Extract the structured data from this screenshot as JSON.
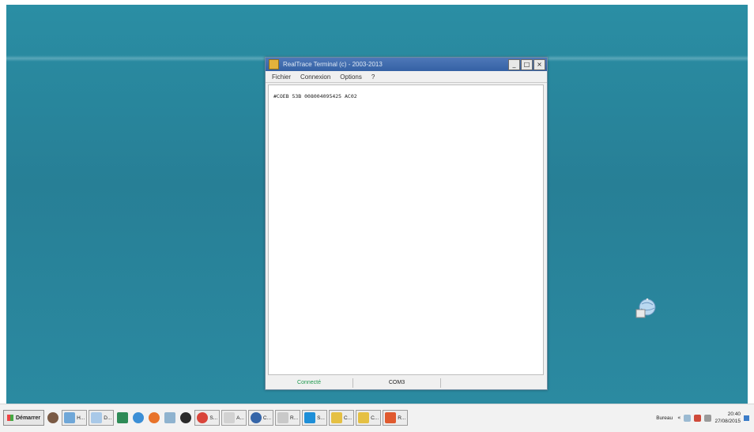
{
  "window": {
    "title": "RealTrace Terminal (c) - 2003-2013",
    "caption": {
      "minimize": "_",
      "maximize": "□",
      "close": "×"
    }
  },
  "menu": [
    "Fichier",
    "Connexion",
    "Options",
    "?"
  ],
  "terminal": {
    "line": "#COEB 53B 008004095425 AC02"
  },
  "statusbar": {
    "connection": "Connecté",
    "port": "COM3"
  },
  "taskbar": {
    "start_label": "Démarrer",
    "items": [
      {
        "label": "",
        "icon": "user-icon",
        "color": "#7a5a45",
        "round": true,
        "button": false
      },
      {
        "label": "H...",
        "icon": "app-icon",
        "color": "#6fa7d8",
        "round": false,
        "button": true
      },
      {
        "label": "D...",
        "icon": "paint-icon",
        "color": "#a9c9e8",
        "round": false,
        "button": true
      },
      {
        "label": "",
        "icon": "excel-icon",
        "color": "#2e8b57",
        "round": false,
        "button": false
      },
      {
        "label": "",
        "icon": "ie-icon",
        "color": "#3c8fd6",
        "round": true,
        "button": false
      },
      {
        "label": "",
        "icon": "firefox-icon",
        "color": "#e8732a",
        "round": true,
        "button": false
      },
      {
        "label": "",
        "icon": "document-icon",
        "color": "#8fb3cf",
        "round": false,
        "button": false
      },
      {
        "label": "",
        "icon": "media-icon",
        "color": "#2a2a2a",
        "round": true,
        "button": false
      },
      {
        "label": "S...",
        "icon": "chrome-icon",
        "color": "#d9453b",
        "round": true,
        "button": true
      },
      {
        "label": "A...",
        "icon": "app-icon",
        "color": "#d2d2d2",
        "round": false,
        "button": true
      },
      {
        "label": "C...",
        "icon": "app-icon",
        "color": "#3565a8",
        "round": true,
        "button": true
      },
      {
        "label": "R...",
        "icon": "app-icon",
        "color": "#c9c9c9",
        "round": false,
        "button": true
      },
      {
        "label": "S...",
        "icon": "skype-icon",
        "color": "#1e8fd8",
        "round": false,
        "button": true
      },
      {
        "label": "C...",
        "icon": "folder-icon",
        "color": "#e5c043",
        "round": false,
        "button": true
      },
      {
        "label": "C...",
        "icon": "folder-icon",
        "color": "#e5c043",
        "round": false,
        "button": true
      },
      {
        "label": "R...",
        "icon": "app-icon",
        "color": "#e05a2f",
        "round": false,
        "button": true
      }
    ],
    "bureau_label": "Bureau",
    "clock_time": "20:40",
    "clock_date": "27/08/2015"
  },
  "colors": {
    "desktop": "#2a8ea4",
    "titlebar": "#3a67ab",
    "status_connected": "#1f9a4f"
  }
}
